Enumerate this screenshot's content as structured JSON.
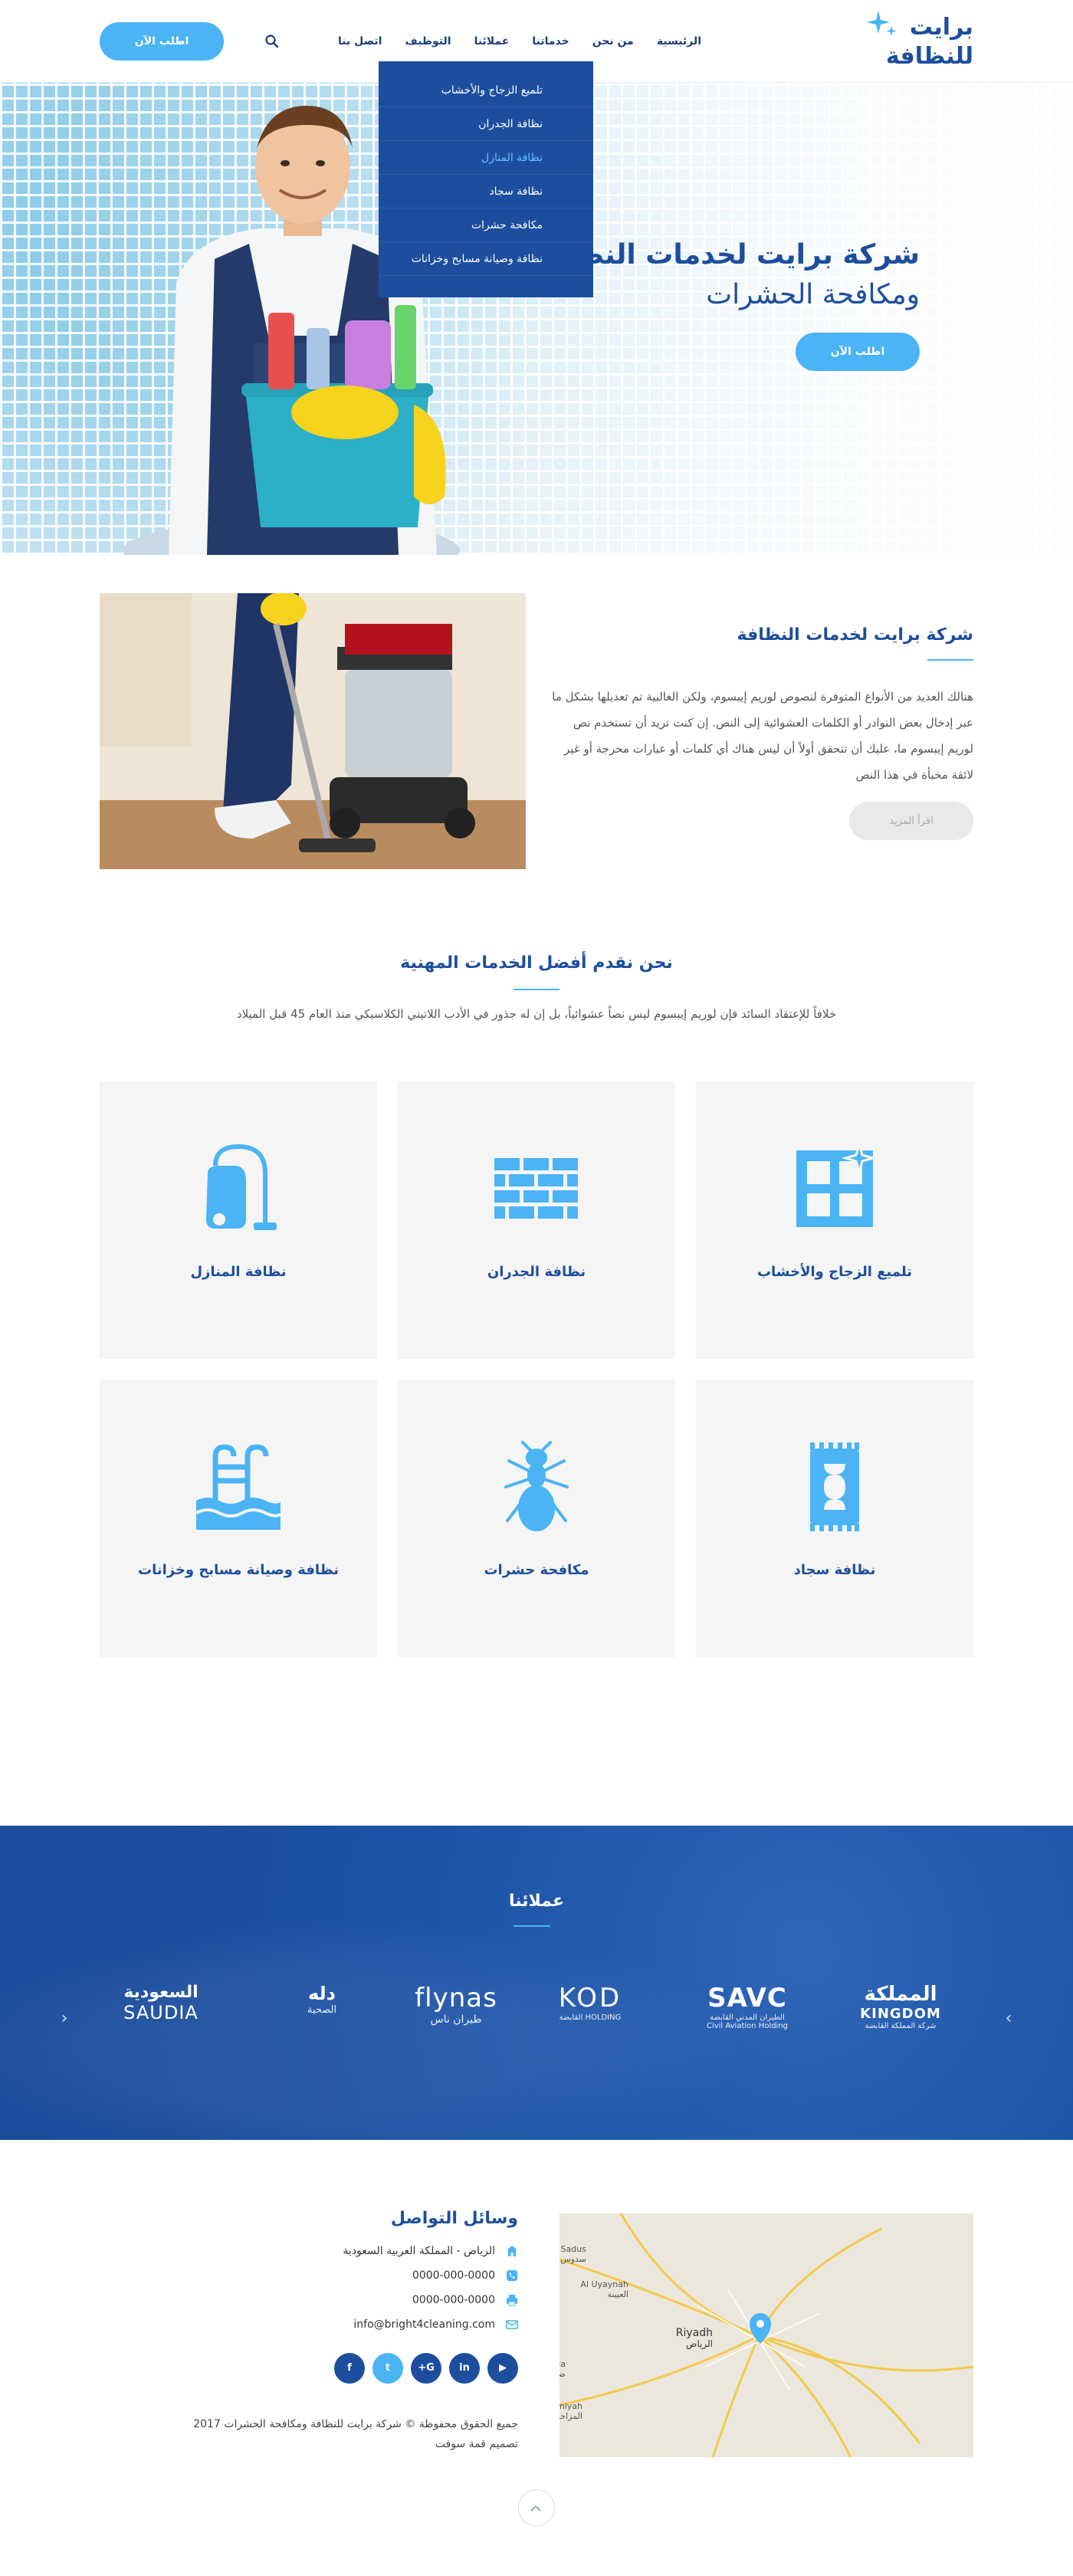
{
  "header": {
    "logo_line1": "برايت",
    "logo_line2": "للنظافة",
    "nav": [
      {
        "label": "الرئيسية"
      },
      {
        "label": "من نحن"
      },
      {
        "label": "خدماتنا"
      },
      {
        "label": "عملائنا"
      },
      {
        "label": "التوظيف"
      },
      {
        "label": "اتصل بنا"
      }
    ],
    "order_label": "اطلب الآن",
    "dropdown": [
      {
        "label": "تلميع الزجاج والأخشاب"
      },
      {
        "label": "نظافة الجدران"
      },
      {
        "label": "نظافة المنازل"
      },
      {
        "label": "نظافة سجاد"
      },
      {
        "label": "مكافحة حشرات"
      },
      {
        "label": "نظافة وصيانة مسابح وخزانات"
      }
    ]
  },
  "hero": {
    "title": "شركة برايت لخدمات النظافة",
    "subtitle": "ومكافحة الحشرات",
    "button": "اطلب الآن"
  },
  "about": {
    "title": "شركة برايت لخدمات النظافة",
    "text": "هنالك العديد من الأنواع المتوفرة لنصوص لوريم إيبسوم، ولكن الغالبية تم تعديلها بشكل ما عبر إدخال بعض النوادر أو الكلمات العشوائية إلى النص. إن كنت تريد أن تستخدم نص لوريم إيبسوم ما، عليك أن تتحقق أولاً أن ليس هناك أي كلمات أو عبارات محرجة أو غير لائقة مخبأة في هذا النص",
    "button": "اقرأ المزيد"
  },
  "services": {
    "title": "نحن نقدم أفضل الخدمات المهنية",
    "description": "خلافاً للإعتقاد السائد فإن لوريم إيبسوم ليس نصاً عشوائياً، بل إن له جذور في الأدب اللاتيني الكلاسيكي منذ العام 45 قبل الميلاد",
    "items": [
      {
        "label": "تلميع الزجاج والأخشاب",
        "icon": "window-icon"
      },
      {
        "label": "نظافة الجدران",
        "icon": "brick-wall-icon"
      },
      {
        "label": "نظافة المنازل",
        "icon": "vacuum-icon"
      },
      {
        "label": "نظافة سجاد",
        "icon": "carpet-icon"
      },
      {
        "label": "مكافحة حشرات",
        "icon": "ant-icon"
      },
      {
        "label": "نظافة وصيانة مسابح وخزانات",
        "icon": "pool-icon"
      }
    ],
    "accent": "#4ab4f5"
  },
  "clients": {
    "title": "عملائنا",
    "logos": [
      {
        "name": "KINGDOM",
        "sub": "شركة المملكة القابضة",
        "ar": "المملكة"
      },
      {
        "name": "SAVC",
        "sub": "Civil Aviation Holding",
        "ar": "الطيران المدني القابضة"
      },
      {
        "name": "KOD",
        "sub": "HOLDING القابضة",
        "ar": ""
      },
      {
        "name": "flynas",
        "sub": "طيران ناس",
        "ar": ""
      },
      {
        "name": "دله",
        "sub": "الصحية",
        "ar": ""
      },
      {
        "name": "SAUDIA",
        "sub": "",
        "ar": "السعودية"
      }
    ]
  },
  "footer": {
    "title": "وسائل التواصل",
    "address": "الرياض - المملكة العربية السعودية",
    "phone": "0000-000-0000",
    "fax": "0000-000-0000",
    "email": "info@bright4cleaning.com",
    "socials": [
      "f",
      "t",
      "G+",
      "in",
      "▶"
    ],
    "copyright": "جميع الحقوق محفوظة © شركة برايت للنظافة ومكافحة الحشرات 2017",
    "design": "تصميم قمة سوفت",
    "map_labels": [
      "Sadus",
      "سدوس",
      "Al Uyaynah",
      "العيينة",
      "Riyadh",
      "الرياض",
      "Dhurma",
      "ضرما",
      "Al Muzahimiyah",
      "المزاحمية"
    ]
  },
  "colors": {
    "brand": "#1d4e9e",
    "accent": "#4ab4f5"
  }
}
